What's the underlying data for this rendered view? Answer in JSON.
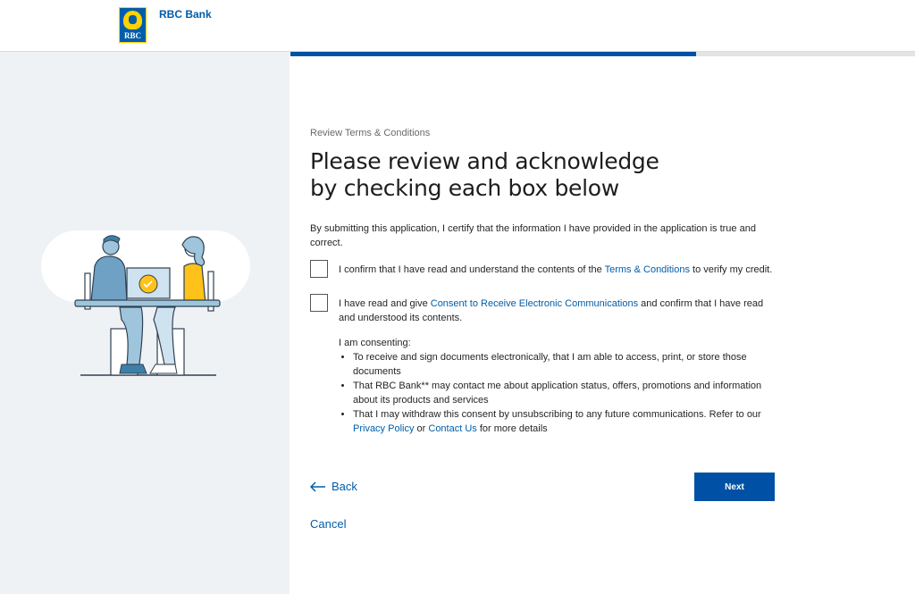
{
  "header": {
    "logo_text": "RBC",
    "brand": "RBC Bank"
  },
  "progress": {
    "fraction": 0.65
  },
  "eyebrow": "Review Terms & Conditions",
  "title": "Please review and acknowledge by checking each box below",
  "certify": "By submitting this application, I certify that the information I have provided in the application is true and correct.",
  "checkbox1": {
    "before": "I confirm that I have read and understand the contents of the ",
    "link": "Terms & Conditions",
    "after": " to verify my credit.",
    "checked": false
  },
  "checkbox2": {
    "before": "I have read and give ",
    "link": "Consent to Receive Electronic Communications",
    "after": " and confirm that I have read and understood its contents.",
    "checked": false
  },
  "consent": {
    "intro": "I am consenting:",
    "item1": "To receive and sign documents electronically, that I am able to access, print, or store those documents",
    "item2": "That RBC Bank** may contact me about application status, offers, promotions and information about its products and services",
    "item3_before": "That I may withdraw this consent by unsubscribing to any future communications. Refer to our ",
    "privacy_link": "Privacy Policy",
    "or": " or ",
    "contact_link": "Contact Us",
    "item3_after": " for more details"
  },
  "buttons": {
    "back": "Back",
    "next": "Next",
    "cancel": "Cancel"
  },
  "colors": {
    "brand_blue": "#005daa",
    "button_blue": "#0051a5",
    "brand_yellow": "#ffd200",
    "panel_bg": "#eef2f4"
  },
  "icons": {
    "back": "arrow-left-icon",
    "illustration": "people-laptop-illustration"
  }
}
